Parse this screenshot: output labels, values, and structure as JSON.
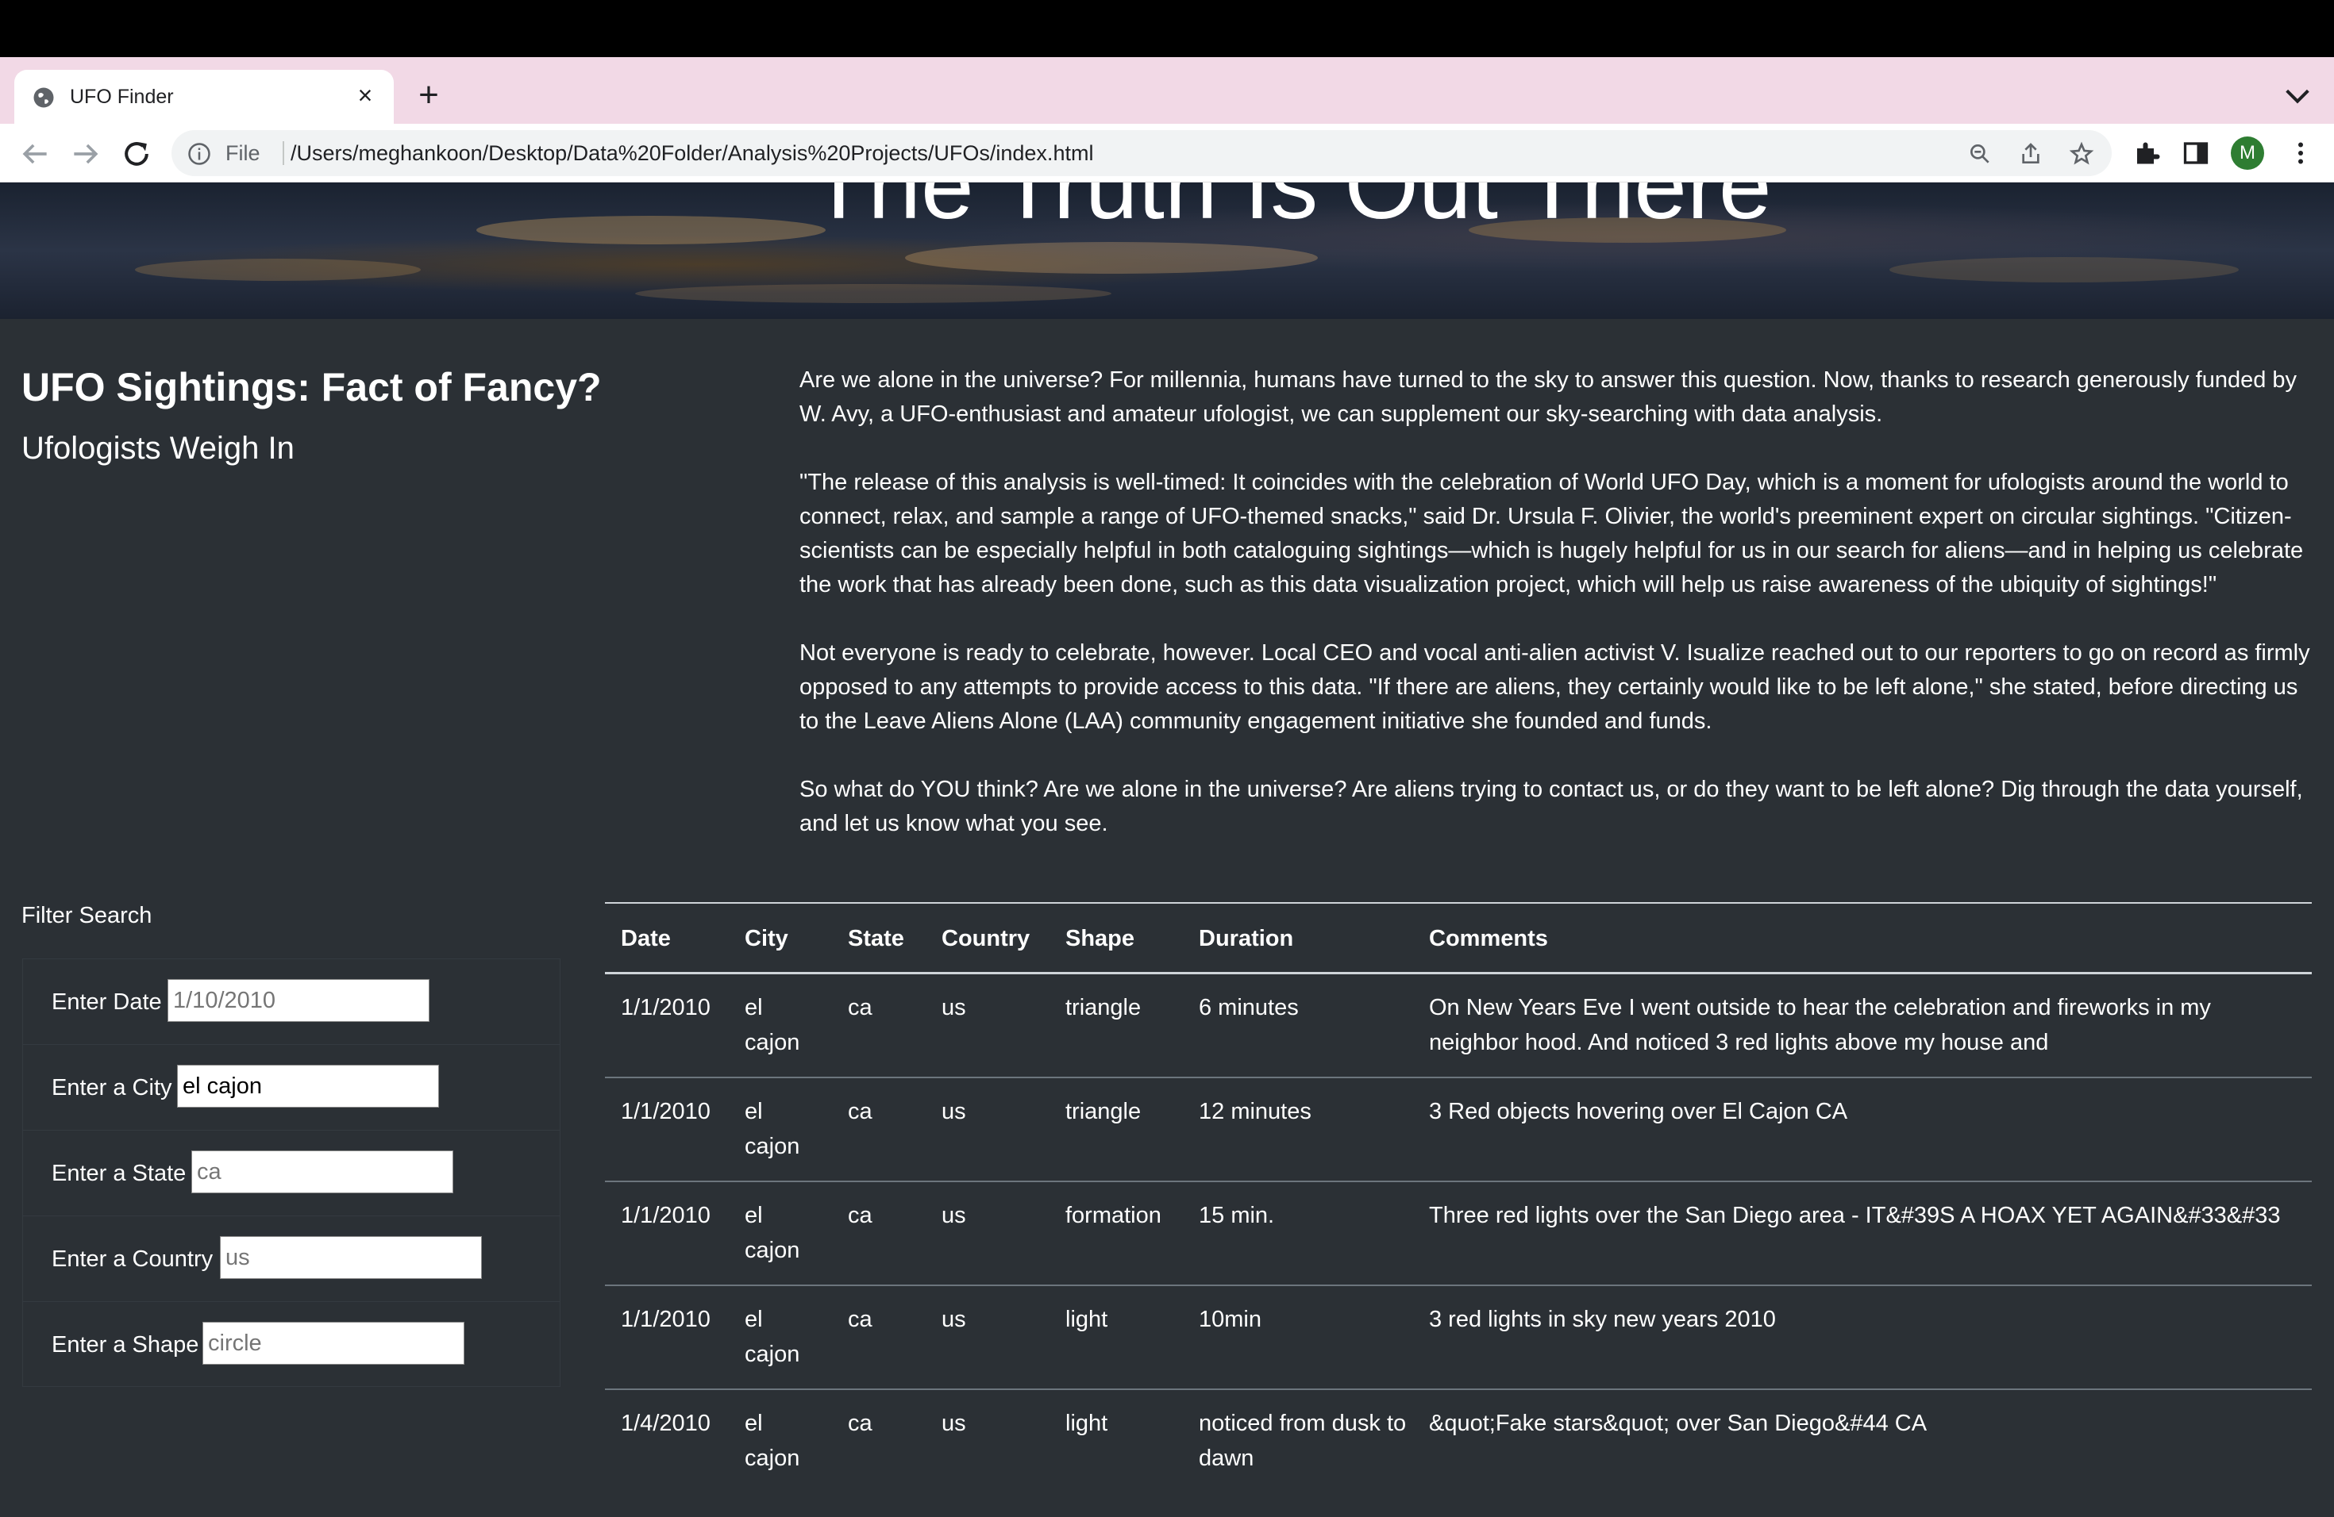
{
  "browser": {
    "tab_title": "UFO Finder",
    "file_label": "File",
    "url": "/Users/meghankoon/Desktop/Data%20Folder/Analysis%20Projects/UFOs/index.html",
    "profile_initial": "M"
  },
  "hero": {
    "title": "The Truth Is Out There"
  },
  "headline": {
    "main": "UFO Sightings: Fact of Fancy?",
    "sub": "Ufologists Weigh In"
  },
  "article": {
    "paragraphs": [
      "Are we alone in the universe? For millennia, humans have turned to the sky to answer this question. Now, thanks to research generously funded by W. Avy, a UFO-enthusiast and amateur ufologist, we can supplement our sky-searching with data analysis.",
      "\"The release of this analysis is well-timed: It coincides with the celebration of World UFO Day, which is a moment for ufologists around the world to connect, relax, and sample a range of UFO-themed snacks,\" said Dr. Ursula F. Olivier, the world's preeminent expert on circular sightings. \"Citizen-scientists can be especially helpful in both cataloguing sightings—which is hugely helpful for us in our search for aliens—and in helping us celebrate the work that has already been done, such as this data visualization project, which will help us raise awareness of the ubiquity of sightings!\"",
      "Not everyone is ready to celebrate, however. Local CEO and vocal anti-alien activist V. Isualize reached out to our reporters to go on record as firmly opposed to any attempts to provide access to this data. \"If there are aliens, they certainly would like to be left alone,\" she stated, before directing us to the Leave Aliens Alone (LAA) community engagement initiative she founded and funds.",
      "So what do YOU think? Are we alone in the universe? Are aliens trying to contact us, or do they want to be left alone? Dig through the data yourself, and let us know what you see."
    ]
  },
  "filter": {
    "title": "Filter Search",
    "fields": [
      {
        "label": "Enter Date",
        "value": "",
        "placeholder": "1/10/2010"
      },
      {
        "label": "Enter a City",
        "value": "el cajon",
        "placeholder": ""
      },
      {
        "label": "Enter a State",
        "value": "",
        "placeholder": "ca"
      },
      {
        "label": "Enter a Country",
        "value": "",
        "placeholder": "us"
      },
      {
        "label": "Enter a Shape",
        "value": "",
        "placeholder": "circle"
      }
    ]
  },
  "table": {
    "headers": [
      "Date",
      "City",
      "State",
      "Country",
      "Shape",
      "Duration",
      "Comments"
    ],
    "rows": [
      [
        "1/1/2010",
        "el cajon",
        "ca",
        "us",
        "triangle",
        "6 minutes",
        "On New Years Eve I went outside to hear the celebration and fireworks in my neighbor hood. And noticed 3 red lights above my house and"
      ],
      [
        "1/1/2010",
        "el cajon",
        "ca",
        "us",
        "triangle",
        "12 minutes",
        "3 Red objects hovering over El Cajon CA"
      ],
      [
        "1/1/2010",
        "el cajon",
        "ca",
        "us",
        "formation",
        "15 min.",
        "Three red lights over the San Diego area - IT&#39S A HOAX YET AGAIN&#33&#33"
      ],
      [
        "1/1/2010",
        "el cajon",
        "ca",
        "us",
        "light",
        "10min",
        "3 red lights in sky new years 2010"
      ],
      [
        "1/4/2010",
        "el cajon",
        "ca",
        "us",
        "light",
        "noticed from dusk to dawn",
        "&quot;Fake stars&quot; over San Diego&#44 CA"
      ]
    ]
  }
}
